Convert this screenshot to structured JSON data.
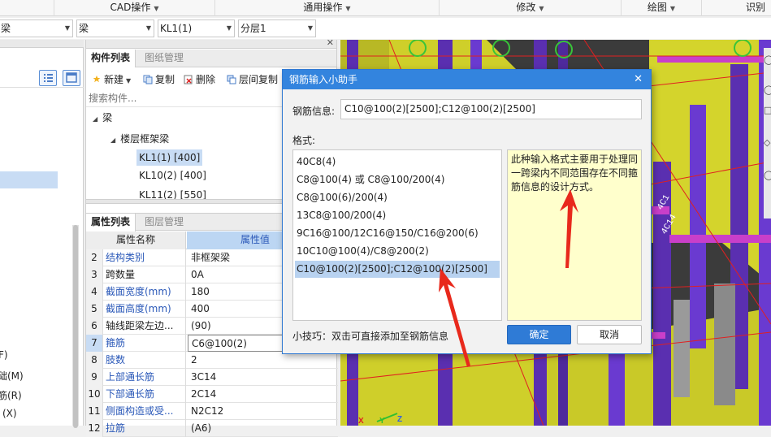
{
  "menu": {
    "cad_ops": "CAD操作",
    "general_ops": "通用操作",
    "modify": "修改",
    "draw": "绘图",
    "identify": "识别"
  },
  "selectors": {
    "sel0": "梁",
    "sel1": "梁",
    "sel2": "KL1(1)",
    "sel3": "分层1"
  },
  "left_panel": {
    "partial_items": [
      "F)",
      "础(M)",
      "筋(R)",
      "(X)"
    ]
  },
  "component_list": {
    "tab_active": "构件列表",
    "tab_inactive": "图纸管理",
    "toolbar": {
      "new": "新建",
      "copy": "复制",
      "delete": "删除",
      "floor_copy": "层间复制"
    },
    "search_placeholder": "搜索构件...",
    "tree": {
      "root": "梁",
      "group": "楼层框架梁",
      "items": [
        "KL1(1) [400]",
        "KL10(2) [400]",
        "KL11(2) [550]"
      ]
    }
  },
  "properties": {
    "tab_active": "属性列表",
    "tab_inactive": "图层管理",
    "col_name": "属性名称",
    "col_value": "属性值",
    "rows": [
      {
        "num": "2",
        "name": "结构类别",
        "value": "非框架梁",
        "blue": true
      },
      {
        "num": "3",
        "name": "跨数量",
        "value": "0A",
        "blue": false
      },
      {
        "num": "4",
        "name": "截面宽度(mm)",
        "value": "180",
        "blue": true
      },
      {
        "num": "5",
        "name": "截面高度(mm)",
        "value": "400",
        "blue": true
      },
      {
        "num": "6",
        "name": "轴线距梁左边...",
        "value": "(90)",
        "blue": false
      },
      {
        "num": "7",
        "name": "箍筋",
        "value": "C6@100(2)",
        "blue": true
      },
      {
        "num": "8",
        "name": "肢数",
        "value": "2",
        "blue": true
      },
      {
        "num": "9",
        "name": "上部通长筋",
        "value": "3C14",
        "blue": true
      },
      {
        "num": "10",
        "name": "下部通长筋",
        "value": "2C14",
        "blue": true
      },
      {
        "num": "11",
        "name": "侧面构造或受...",
        "value": "N2C12",
        "blue": true
      },
      {
        "num": "12",
        "name": "拉筋",
        "value": "(A6)",
        "blue": true
      }
    ]
  },
  "dialog": {
    "title": "钢筋输入小助手",
    "info_label": "钢筋信息:",
    "info_value": "C10@100(2)[2500];C12@100(2)[2500]",
    "format_label": "格式:",
    "formats": [
      "40C8(4)",
      "C8@100(4) 或 C8@100/200(4)",
      "C8@100(6)/200(4)",
      "13C8@100/200(4)",
      "9C16@100/12C16@150/C16@200(6)",
      "10C10@100(4)/C8@200(2)",
      "C10@100(2)[2500];C12@100(2)[2500]"
    ],
    "description": "此种输入格式主要用于处理同一跨梁内不同范围存在不同箍筋信息的设计方式。",
    "tip": "小技巧：双击可直接添加至钢筋信息",
    "ok": "确定",
    "cancel": "取消"
  },
  "colors": {
    "accent": "#3384de",
    "selection": "#b8d2f0",
    "annotation_arrow": "#e8291c",
    "hint_background": "#ffffcc",
    "canvas_yellow": "#d9d92c",
    "canvas_purple": "#5a2fb0"
  }
}
